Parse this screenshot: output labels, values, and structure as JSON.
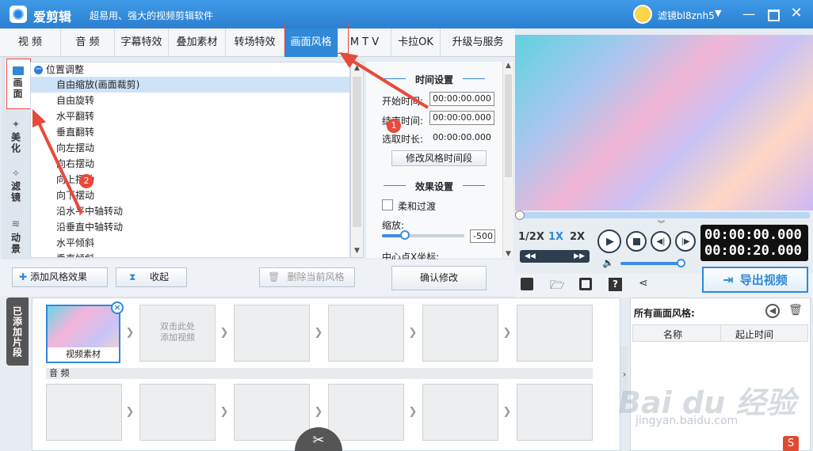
{
  "window": {
    "app_name": "爱剪辑",
    "slogan": "超易用、强大的视频剪辑软件",
    "username": "滤镜bl8znh5",
    "dropdown": "▼",
    "minimize": "—",
    "close": "✕"
  },
  "tabs": [
    {
      "label": "视  频",
      "active": false
    },
    {
      "label": "音  频",
      "active": false
    },
    {
      "label": "字幕特效",
      "active": false
    },
    {
      "label": "叠加素材",
      "active": false
    },
    {
      "label": "转场特效",
      "active": false
    },
    {
      "label": "画面风格",
      "active": true
    },
    {
      "label": "M T V",
      "active": false
    },
    {
      "label": "卡拉OK",
      "active": false
    },
    {
      "label": "升级与服务",
      "active": false
    }
  ],
  "sidebar": [
    {
      "label": "画面",
      "icon": "screen-icon",
      "active": true
    },
    {
      "label": "美化",
      "icon": "magic-wand-icon",
      "active": false
    },
    {
      "label": "滤镜",
      "icon": "filter-wand-icon",
      "active": false
    },
    {
      "label": "动景",
      "icon": "wave-icon",
      "active": false
    }
  ],
  "style_list": {
    "group": "位置调整",
    "items": [
      "自由缩放(画面裁剪)",
      "自由旋转",
      "水平翻转",
      "垂直翻转",
      "向左摆动",
      "向右摆动",
      "向上摆动",
      "向下摆动",
      "沿水平中轴转动",
      "沿垂直中轴转动",
      "水平倾斜",
      "垂直倾斜"
    ],
    "selected_index": 0
  },
  "time_settings": {
    "title": "时间设置",
    "start_label": "开始时间:",
    "start_value": "00:00:00.000",
    "end_label": "结束时间:",
    "end_value": "00:00:00.000",
    "duration_label": "选取时长:",
    "duration_value": "00:00:00.000",
    "modify_button": "修改风格时间段"
  },
  "effect_settings": {
    "title": "效果设置",
    "smooth_label": "柔和过渡",
    "zoom_label": "缩放:",
    "zoom_value": "-500",
    "center_label": "中心点X坐标:"
  },
  "bottom_buttons": {
    "add_effect": "添加风格效果",
    "collapse": "收起",
    "delete_current": "删除当前风格",
    "confirm": "确认修改"
  },
  "player": {
    "speeds": [
      "1/2X",
      "1X",
      "2X"
    ],
    "active_speed": "1X",
    "current_time": "00:00:00.000",
    "total_time": "00:00:20.000",
    "export_label": "导出视频"
  },
  "timeline": {
    "added_tab": "已添加片段",
    "first_clip_label": "视频素材",
    "placeholder": "双击此处\n添加视频",
    "audio_label": "音 频",
    "close": "×"
  },
  "style_panel": {
    "title": "所有画面风格:",
    "col_name": "名称",
    "col_time": "起止时间"
  },
  "annotations": {
    "badge1": "1",
    "badge2": "2"
  },
  "watermark": {
    "main": "Bai du 经验",
    "sub": "jingyan.baidu.com",
    "logo": "S"
  },
  "colors": {
    "accent": "#2f88d8",
    "annotation": "#e74a3b",
    "titlebar": "#2b7fd1"
  }
}
